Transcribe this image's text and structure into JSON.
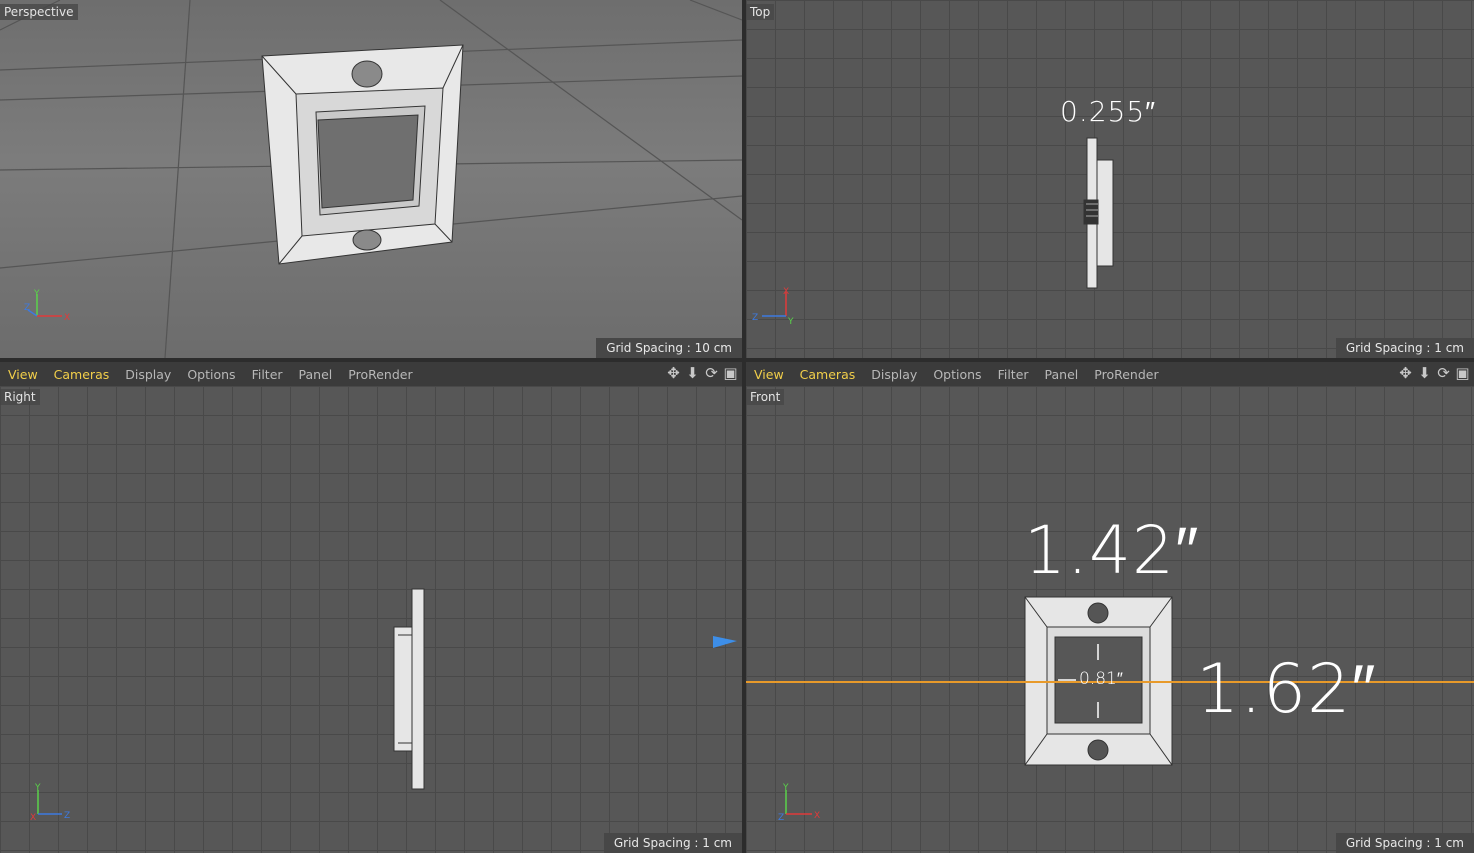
{
  "viewports": {
    "perspective": {
      "label": "Perspective",
      "grid_spacing": "Grid Spacing : 10 cm"
    },
    "top": {
      "label": "Top",
      "grid_spacing": "Grid Spacing : 1 cm",
      "dimension": "0.255″"
    },
    "right": {
      "label": "Right",
      "grid_spacing": "Grid Spacing : 1 cm"
    },
    "front": {
      "label": "Front",
      "grid_spacing": "Grid Spacing : 1 cm",
      "dimension_width": "1.42″",
      "dimension_height": "1.62″",
      "dimension_inner": "0.81″"
    }
  },
  "menu": {
    "items": [
      "View",
      "Cameras",
      "Display",
      "Options",
      "Filter",
      "Panel",
      "ProRender"
    ]
  },
  "axes": {
    "x": "X",
    "y": "Y",
    "z": "Z"
  },
  "icons": [
    "move-icon",
    "zoom-icon",
    "rotate-icon",
    "maximize-icon"
  ],
  "colors": {
    "menu_active": "#f2cf4a",
    "axis_x": "#e03a3a",
    "axis_y": "#5ad24a",
    "axis_z": "#3d7ae0",
    "guide_line": "#e89a2a",
    "object_fill": "#e6e6e6"
  }
}
